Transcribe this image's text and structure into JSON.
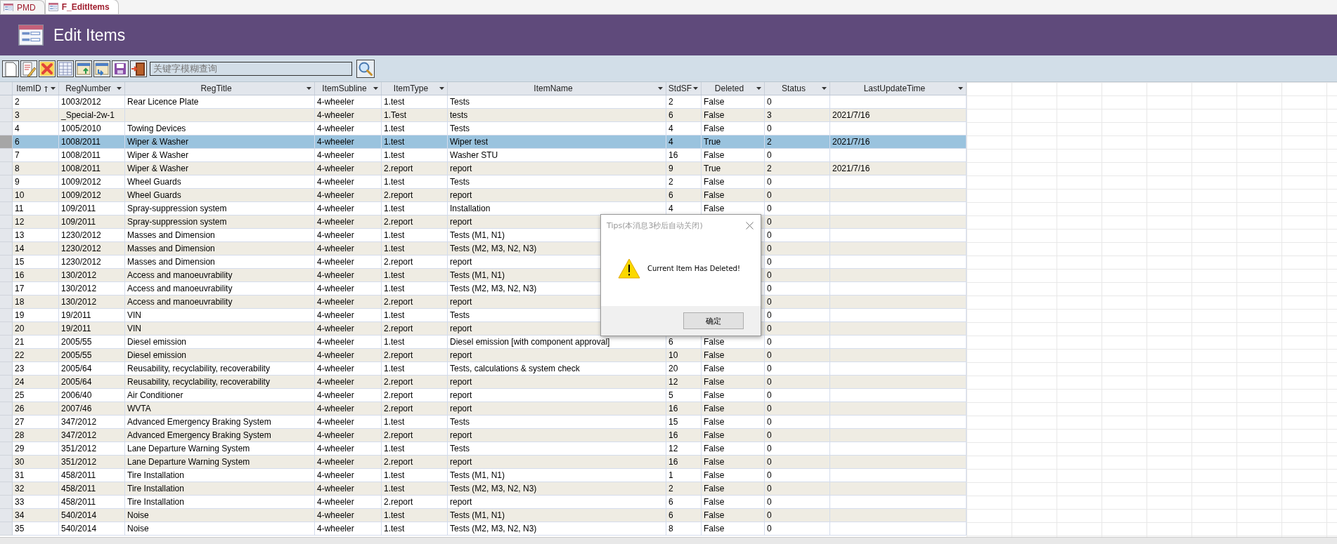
{
  "tabs": [
    {
      "label": "PMD",
      "selected": false
    },
    {
      "label": "F_EditItems",
      "selected": true
    }
  ],
  "header": {
    "title": "Edit Items"
  },
  "toolbar": {
    "search": {
      "placeholder": "关键字模糊查询"
    }
  },
  "table": {
    "columns": [
      {
        "label": "ItemID",
        "sorted": true
      },
      {
        "label": "RegNumber",
        "sorted": false
      },
      {
        "label": "RegTitle",
        "sorted": false
      },
      {
        "label": "ItemSubline",
        "sorted": false
      },
      {
        "label": "ItemType",
        "sorted": false
      },
      {
        "label": "ItemName",
        "sorted": false
      },
      {
        "label": "StdSF",
        "sorted": false
      },
      {
        "label": "Deleted",
        "sorted": false
      },
      {
        "label": "Status",
        "sorted": false
      },
      {
        "label": "LastUpdateTime",
        "sorted": false
      }
    ],
    "rows": [
      {
        "selected": false,
        "cells": [
          "2",
          "1003/2012",
          "Rear Licence Plate",
          "4-wheeler",
          "1.test",
          "Tests",
          "2",
          "False",
          "0",
          null
        ]
      },
      {
        "selected": false,
        "cells": [
          "3",
          "_Special-2w-1",
          null,
          "4-wheeler",
          "1.Test",
          "tests",
          "6",
          "False",
          "3",
          "2021/7/16"
        ]
      },
      {
        "selected": false,
        "cells": [
          "4",
          "1005/2010",
          "Towing Devices",
          "4-wheeler",
          "1.test",
          "Tests",
          "4",
          "False",
          "0",
          null
        ]
      },
      {
        "selected": true,
        "cells": [
          "6",
          "1008/2011",
          "Wiper & Washer",
          "4-wheeler",
          "1.test",
          "Wiper test",
          "4",
          "True",
          "2",
          "2021/7/16"
        ]
      },
      {
        "selected": false,
        "cells": [
          "7",
          "1008/2011",
          "Wiper & Washer",
          "4-wheeler",
          "1.test",
          "Washer STU",
          "16",
          "False",
          "0",
          null
        ]
      },
      {
        "selected": false,
        "cells": [
          "8",
          "1008/2011",
          "Wiper & Washer",
          "4-wheeler",
          "2.report",
          "report",
          "9",
          "True",
          "2",
          "2021/7/16"
        ]
      },
      {
        "selected": false,
        "cells": [
          "9",
          "1009/2012",
          "Wheel Guards",
          "4-wheeler",
          "1.test",
          "Tests",
          "2",
          "False",
          "0",
          null
        ]
      },
      {
        "selected": false,
        "cells": [
          "10",
          "1009/2012",
          "Wheel Guards",
          "4-wheeler",
          "2.report",
          "report",
          "6",
          "False",
          "0",
          null
        ]
      },
      {
        "selected": false,
        "cells": [
          "11",
          "109/2011",
          "Spray-suppression system",
          "4-wheeler",
          "1.test",
          "Installation",
          "4",
          "False",
          "0",
          null
        ]
      },
      {
        "selected": false,
        "cells": [
          "12",
          "109/2011",
          "Spray-suppression system",
          "4-wheeler",
          "2.report",
          "report",
          null,
          null,
          "0",
          null
        ]
      },
      {
        "selected": false,
        "cells": [
          "13",
          "1230/2012",
          "Masses and Dimension",
          "4-wheeler",
          "1.test",
          "Tests (M1, N1)",
          null,
          null,
          "0",
          null
        ]
      },
      {
        "selected": false,
        "cells": [
          "14",
          "1230/2012",
          "Masses and Dimension",
          "4-wheeler",
          "1.test",
          "Tests (M2, M3, N2, N3)",
          null,
          null,
          "0",
          null
        ]
      },
      {
        "selected": false,
        "cells": [
          "15",
          "1230/2012",
          "Masses and Dimension",
          "4-wheeler",
          "2.report",
          "report",
          null,
          null,
          "0",
          null
        ]
      },
      {
        "selected": false,
        "cells": [
          "16",
          "130/2012",
          "Access and manoeuvrability",
          "4-wheeler",
          "1.test",
          "Tests (M1, N1)",
          null,
          null,
          "0",
          null
        ]
      },
      {
        "selected": false,
        "cells": [
          "17",
          "130/2012",
          "Access and manoeuvrability",
          "4-wheeler",
          "1.test",
          "Tests (M2, M3, N2, N3)",
          null,
          null,
          "0",
          null
        ]
      },
      {
        "selected": false,
        "cells": [
          "18",
          "130/2012",
          "Access and manoeuvrability",
          "4-wheeler",
          "2.report",
          "report",
          null,
          null,
          "0",
          null
        ]
      },
      {
        "selected": false,
        "cells": [
          "19",
          "19/2011",
          "VIN",
          "4-wheeler",
          "1.test",
          "Tests",
          null,
          null,
          "0",
          null
        ]
      },
      {
        "selected": false,
        "cells": [
          "20",
          "19/2011",
          "VIN",
          "4-wheeler",
          "2.report",
          "report",
          null,
          null,
          "0",
          null
        ]
      },
      {
        "selected": false,
        "cells": [
          "21",
          "2005/55",
          "Diesel emission",
          "4-wheeler",
          "1.test",
          "Diesel emission [with component approval]",
          "6",
          "False",
          "0",
          null
        ]
      },
      {
        "selected": false,
        "cells": [
          "22",
          "2005/55",
          "Diesel emission",
          "4-wheeler",
          "2.report",
          "report",
          "10",
          "False",
          "0",
          null
        ]
      },
      {
        "selected": false,
        "cells": [
          "23",
          "2005/64",
          "Reusability, recyclability, recoverability",
          "4-wheeler",
          "1.test",
          "Tests, calculations & system check",
          "20",
          "False",
          "0",
          null
        ]
      },
      {
        "selected": false,
        "cells": [
          "24",
          "2005/64",
          "Reusability, recyclability, recoverability",
          "4-wheeler",
          "2.report",
          "report",
          "12",
          "False",
          "0",
          null
        ]
      },
      {
        "selected": false,
        "cells": [
          "25",
          "2006/40",
          "Air Conditioner",
          "4-wheeler",
          "2.report",
          "report",
          "5",
          "False",
          "0",
          null
        ]
      },
      {
        "selected": false,
        "cells": [
          "26",
          "2007/46",
          "WVTA",
          "4-wheeler",
          "2.report",
          "report",
          "16",
          "False",
          "0",
          null
        ]
      },
      {
        "selected": false,
        "cells": [
          "27",
          "347/2012",
          "Advanced Emergency Braking System",
          "4-wheeler",
          "1.test",
          "Tests",
          "15",
          "False",
          "0",
          null
        ]
      },
      {
        "selected": false,
        "cells": [
          "28",
          "347/2012",
          "Advanced Emergency Braking System",
          "4-wheeler",
          "2.report",
          "report",
          "16",
          "False",
          "0",
          null
        ]
      },
      {
        "selected": false,
        "cells": [
          "29",
          "351/2012",
          "Lane Departure Warning System",
          "4-wheeler",
          "1.test",
          "Tests",
          "12",
          "False",
          "0",
          null
        ]
      },
      {
        "selected": false,
        "cells": [
          "30",
          "351/2012",
          "Lane Departure Warning System",
          "4-wheeler",
          "2.report",
          "report",
          "16",
          "False",
          "0",
          null
        ]
      },
      {
        "selected": false,
        "cells": [
          "31",
          "458/2011",
          "Tire Installation",
          "4-wheeler",
          "1.test",
          "Tests (M1, N1)",
          "1",
          "False",
          "0",
          null
        ]
      },
      {
        "selected": false,
        "cells": [
          "32",
          "458/2011",
          "Tire Installation",
          "4-wheeler",
          "1.test",
          "Tests (M2, M3, N2, N3)",
          "2",
          "False",
          "0",
          null
        ]
      },
      {
        "selected": false,
        "cells": [
          "33",
          "458/2011",
          "Tire Installation",
          "4-wheeler",
          "2.report",
          "report",
          "6",
          "False",
          "0",
          null
        ]
      },
      {
        "selected": false,
        "cells": [
          "34",
          "540/2014",
          "Noise",
          "4-wheeler",
          "1.test",
          "Tests (M1, N1)",
          "6",
          "False",
          "0",
          null
        ]
      },
      {
        "selected": false,
        "cells": [
          "35",
          "540/2014",
          "Noise",
          "4-wheeler",
          "1.test",
          "Tests (M2, M3, N2, N3)",
          "8",
          "False",
          "0",
          null
        ]
      }
    ]
  },
  "dialog": {
    "title": "Tips(本消息3秒后自动关闭)",
    "message": "Current Item Has Deleted!",
    "button": "确定"
  }
}
